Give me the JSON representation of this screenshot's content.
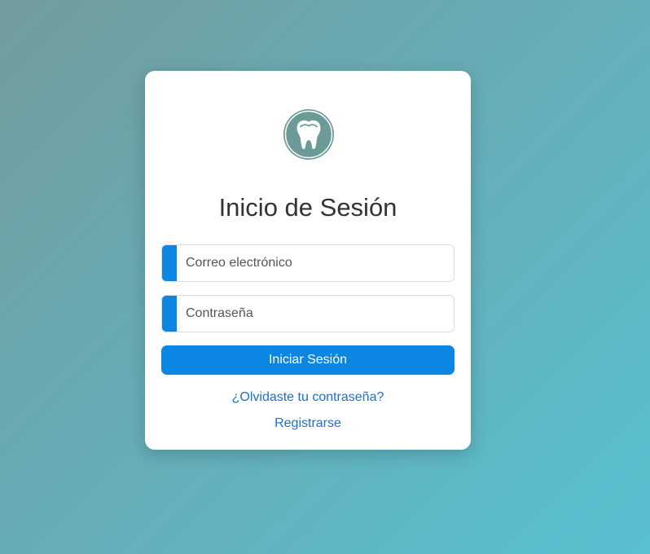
{
  "login": {
    "title": "Inicio de Sesión",
    "email_placeholder": "Correo electrónico",
    "password_placeholder": "Contraseña",
    "submit_label": "Iniciar Sesión",
    "forgot_link": "¿Olvidaste tu contraseña?",
    "register_link": "Registrarse"
  },
  "logo": {
    "icon": "tooth-icon",
    "color": "#6b9a97"
  },
  "colors": {
    "accent": "#0b86e3",
    "link": "#1a6fd6",
    "background_start": "#729c9c",
    "background_end": "#58c0d0"
  }
}
